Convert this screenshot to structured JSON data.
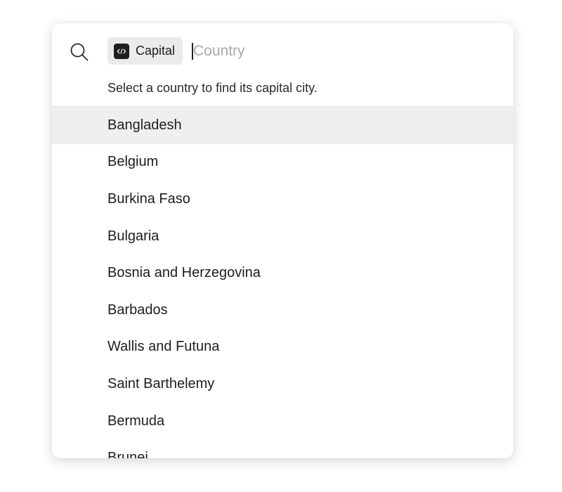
{
  "search": {
    "command_chip_label": "Capital",
    "command_chip_icon": "code-brackets-icon",
    "placeholder": "Country",
    "value": ""
  },
  "hint": "Select a country to find its capital city.",
  "results": [
    {
      "label": "Bangladesh",
      "selected": true
    },
    {
      "label": "Belgium",
      "selected": false
    },
    {
      "label": "Burkina Faso",
      "selected": false
    },
    {
      "label": "Bulgaria",
      "selected": false
    },
    {
      "label": "Bosnia and Herzegovina",
      "selected": false
    },
    {
      "label": "Barbados",
      "selected": false
    },
    {
      "label": "Wallis and Futuna",
      "selected": false
    },
    {
      "label": "Saint Barthelemy",
      "selected": false
    },
    {
      "label": "Bermuda",
      "selected": false
    },
    {
      "label": "Brunei",
      "selected": false
    }
  ],
  "colors": {
    "selected_background": "#efefef",
    "chip_background": "#ebebeb",
    "chip_icon_background": "#1f1f1f",
    "placeholder_text": "#a8a8a8"
  }
}
